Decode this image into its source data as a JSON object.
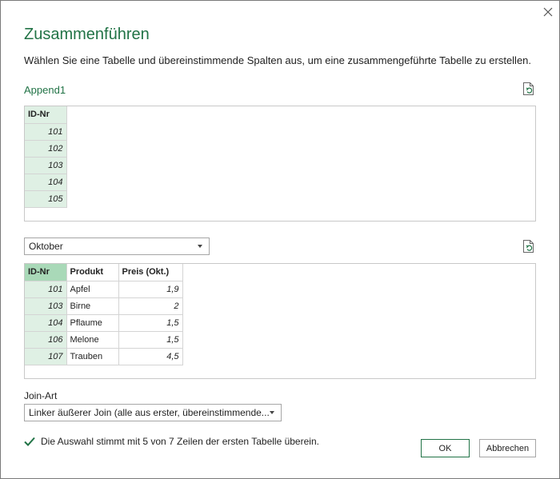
{
  "dialog": {
    "title": "Zusammenführen",
    "subtitle": "Wählen Sie eine Tabelle und übereinstimmende Spalten aus, um eine zusammengeführte Tabelle zu erstellen."
  },
  "first_table": {
    "name": "Append1",
    "columns": [
      "ID-Nr"
    ],
    "rows": [
      [
        "101"
      ],
      [
        "102"
      ],
      [
        "103"
      ],
      [
        "104"
      ],
      [
        "105"
      ]
    ]
  },
  "second_table": {
    "selected": "Oktober",
    "columns": [
      "ID-Nr",
      "Produkt",
      "Preis (Okt.)"
    ],
    "rows": [
      [
        "101",
        "Apfel",
        "1,9"
      ],
      [
        "103",
        "Birne",
        "2"
      ],
      [
        "104",
        "Pflaume",
        "1,5"
      ],
      [
        "106",
        "Melone",
        "1,5"
      ],
      [
        "107",
        "Trauben",
        "4,5"
      ]
    ]
  },
  "join": {
    "label": "Join-Art",
    "selected": "Linker äußerer Join (alle aus erster, übereinstimmende..."
  },
  "status": {
    "text": "Die Auswahl stimmt mit 5 von 7 Zeilen der ersten Tabelle überein."
  },
  "buttons": {
    "ok": "OK",
    "cancel": "Abbrechen"
  },
  "icons": {
    "close": "close-icon",
    "refresh": "refresh-icon",
    "check": "checkmark-icon",
    "dropdown": "chevron-down-icon"
  },
  "colors": {
    "accent": "#217346",
    "key_column": "#dff0e4",
    "key_column_selected": "#a9d9b8"
  }
}
